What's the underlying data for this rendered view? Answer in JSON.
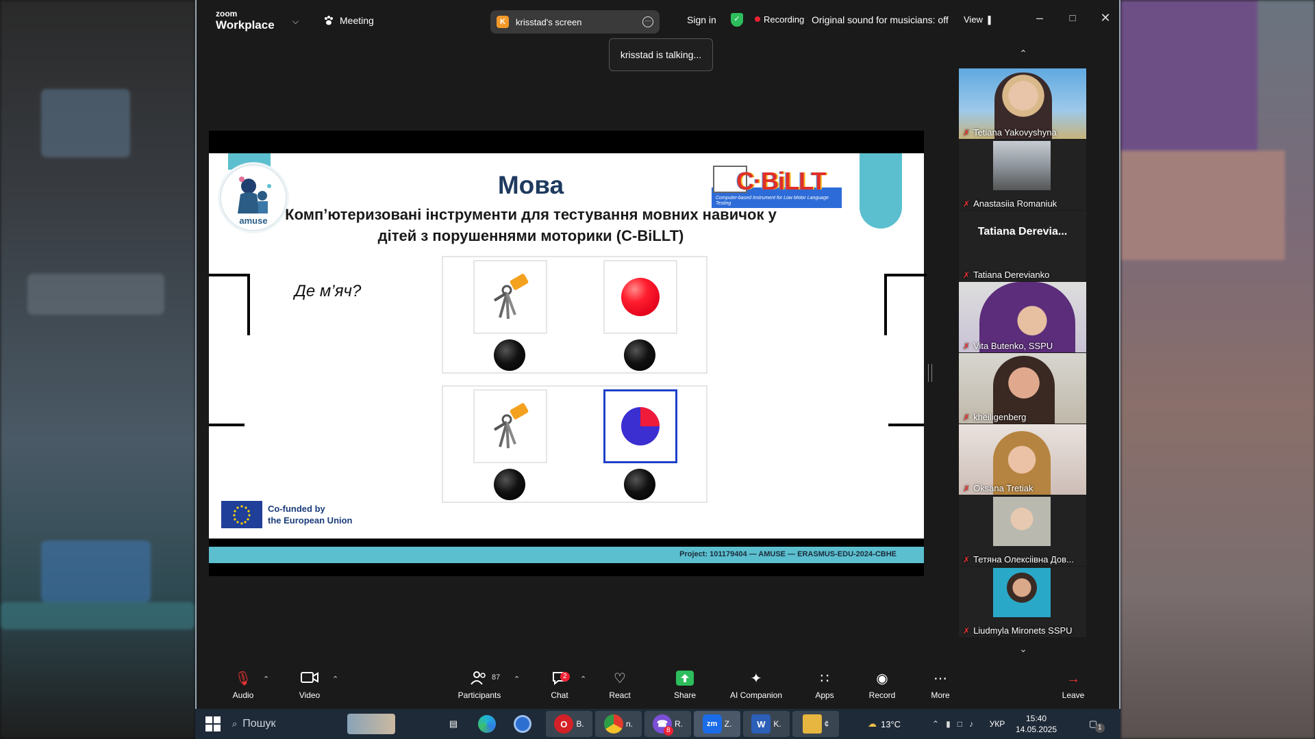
{
  "titlebar": {
    "logo_top": "zoom",
    "logo_bottom": "Workplace",
    "meeting_label": "Meeting",
    "screen_initial": "K",
    "screen_name": "krisstad's screen",
    "sign_in": "Sign in",
    "recording": "Recording",
    "original_sound": "Original sound for musicians: off",
    "view": "View"
  },
  "tooltip": "krisstad is talking...",
  "slide": {
    "title": "Мова",
    "subtitle_line1": "Комп’ютеризовані інструменти для тестування мовних навичок у",
    "subtitle_line2": "дітей з порушеннями моторики (C-BiLLT)",
    "amuse_label": "amuse",
    "cbillt_logo": "C·BiLLT",
    "cbillt_tagline": "Computer-based Instrument for Low Motor Language Testing",
    "question": "Де м’яч?",
    "eu_line1": "Co-funded by",
    "eu_line2": "the European Union",
    "project": "Project: 101179404 — AMUSE — ERASMUS-EDU-2024-CBHE"
  },
  "gallery": {
    "placeholder_name": "Tatiana  Derevia...",
    "participants": [
      "Tetiana Yakovyshyna",
      "Anastasiia Romaniuk",
      "Tatiana Derevianko",
      "Vita Butenko, SSPU",
      "kheiligenberg",
      "Oksana Tretiak",
      "Тетяна Олексіівна Дов...",
      "Liudmyla Mironets SSPU"
    ]
  },
  "toolbar": {
    "audio": "Audio",
    "video": "Video",
    "participants": "Participants",
    "participants_count": "87",
    "chat": "Chat",
    "chat_badge": "2",
    "react": "React",
    "share": "Share",
    "ai": "AI Companion",
    "apps": "Apps",
    "record": "Record",
    "more": "More",
    "leave": "Leave"
  },
  "taskbar": {
    "search": "Пошук",
    "apps": [
      {
        "letter": "B.",
        "color": "#d42027"
      },
      {
        "letter": "n.",
        "color": "#2e9d48"
      },
      {
        "letter": "R.",
        "color": "#7b4fd6"
      },
      {
        "letter": "Z.",
        "color": "#1a6ce8"
      },
      {
        "letter": "K.",
        "color": "#2b5fb8"
      },
      {
        "letter": "¢",
        "color": "#e6b640"
      }
    ],
    "viber_badge": "8",
    "weather": "13°C",
    "lang": "УКР",
    "time": "15:40",
    "date": "14.05.2025",
    "notif": "1"
  },
  "colors": {
    "teal": "#5bbfcf",
    "recording_red": "#ee2233",
    "share_green": "#2dbd5c",
    "selection_blue": "#1e40c8"
  }
}
